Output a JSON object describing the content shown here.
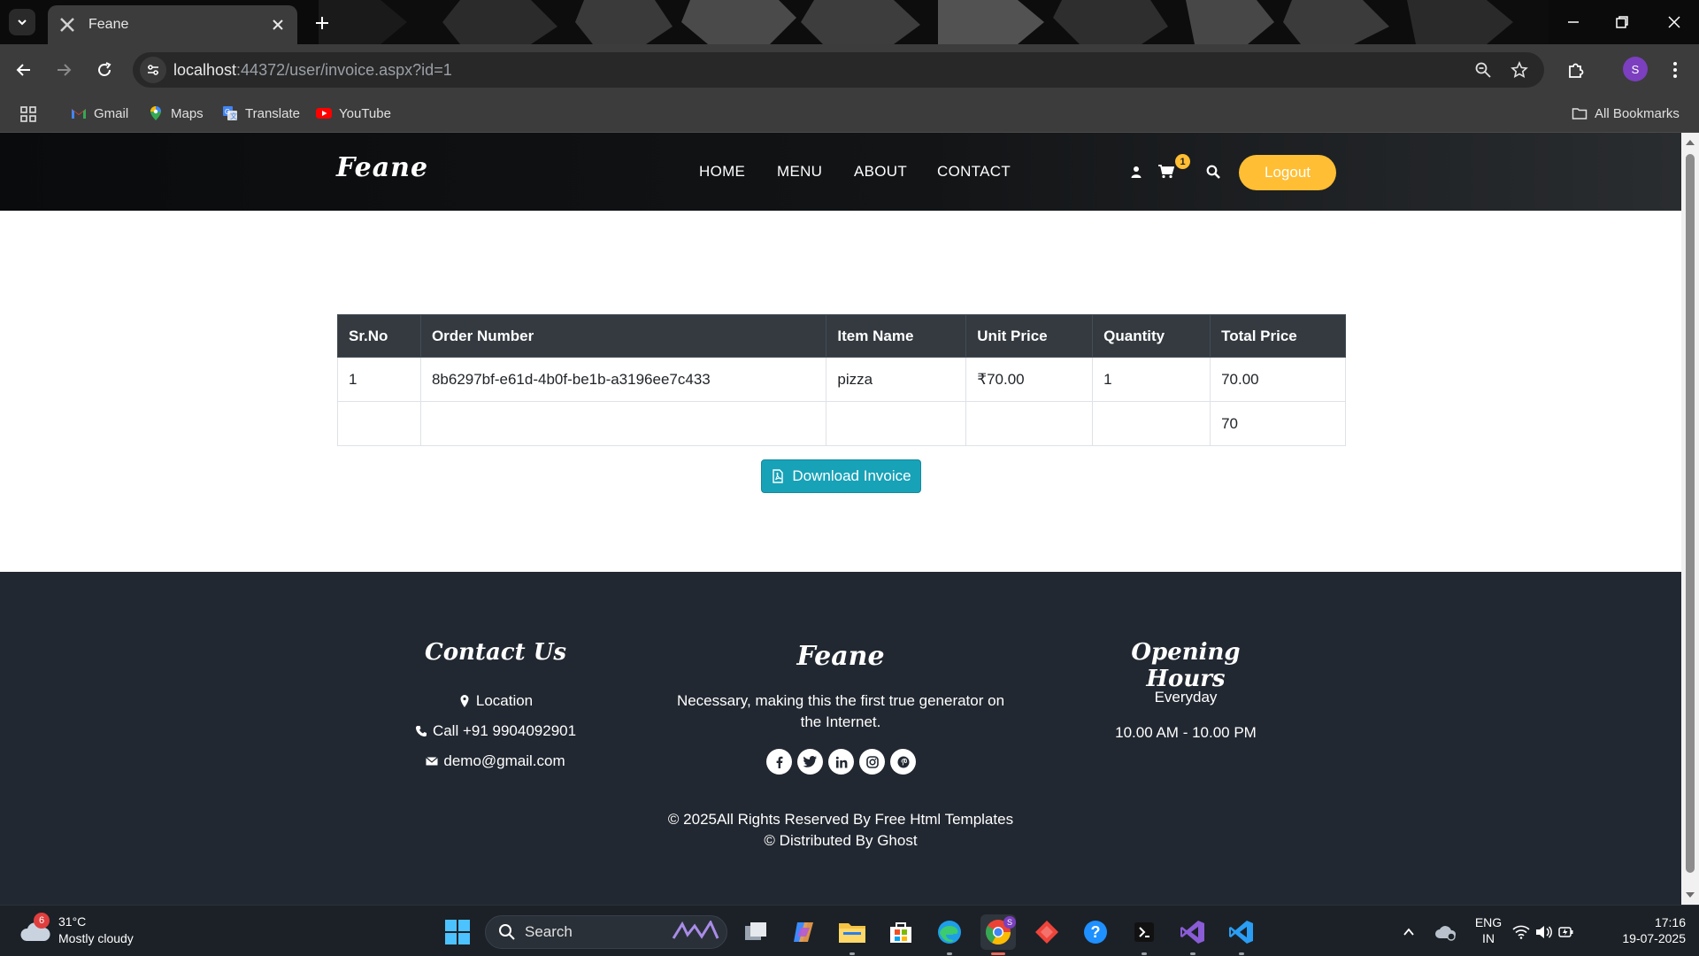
{
  "browser": {
    "tab_title": "Feane",
    "url_host": "localhost",
    "url_rest": ":44372/user/invoice.aspx?id=1",
    "profile_initial": "S",
    "bookmarks": [
      {
        "label": "Gmail",
        "icon": "gmail-icon"
      },
      {
        "label": "Maps",
        "icon": "maps-icon"
      },
      {
        "label": "Translate",
        "icon": "translate-icon"
      },
      {
        "label": "YouTube",
        "icon": "youtube-icon"
      }
    ],
    "all_bookmarks_label": "All Bookmarks"
  },
  "site": {
    "brand": "Feane",
    "nav": [
      "HOME",
      "MENU",
      "ABOUT",
      "CONTACT"
    ],
    "cart_count": "1",
    "logout_label": "Logout",
    "accent_color": "#ffbe33"
  },
  "invoice": {
    "columns": [
      "Sr.No",
      "Order Number",
      "Item Name",
      "Unit Price",
      "Quantity",
      "Total Price"
    ],
    "rows": [
      [
        "1",
        "8b6297bf-e61d-4b0f-be1b-a3196ee7c433",
        "pizza",
        "₹70.00",
        "1",
        "70.00"
      ],
      [
        "",
        "",
        "",
        "",
        "",
        "70"
      ]
    ],
    "download_label": "Download Invoice",
    "download_color": "#17a2b8"
  },
  "footer": {
    "contact_heading": "Contact Us",
    "location": "Location",
    "phone": "Call +91 9904092901",
    "email": "demo@gmail.com",
    "brand": "Feane",
    "about": "Necessary, making this the first true generator on the Internet.",
    "socials": [
      "facebook-icon",
      "twitter-icon",
      "linkedin-icon",
      "instagram-icon",
      "pinterest-icon"
    ],
    "hours_heading": "Opening Hours",
    "hours_days": "Everyday",
    "hours_time": "10.00 AM - 10.00 PM",
    "copyright_line1": "© 2025All Rights Reserved By Free Html Templates",
    "copyright_line2": "© Distributed By Ghost"
  },
  "taskbar": {
    "weather_badge": "6",
    "weather_temp": "31°C",
    "weather_desc": "Mostly cloudy",
    "search_label": "Search",
    "chrome_badge": "S",
    "lang_line1": "ENG",
    "lang_line2": "IN",
    "time": "17:16",
    "date": "19-07-2025"
  }
}
